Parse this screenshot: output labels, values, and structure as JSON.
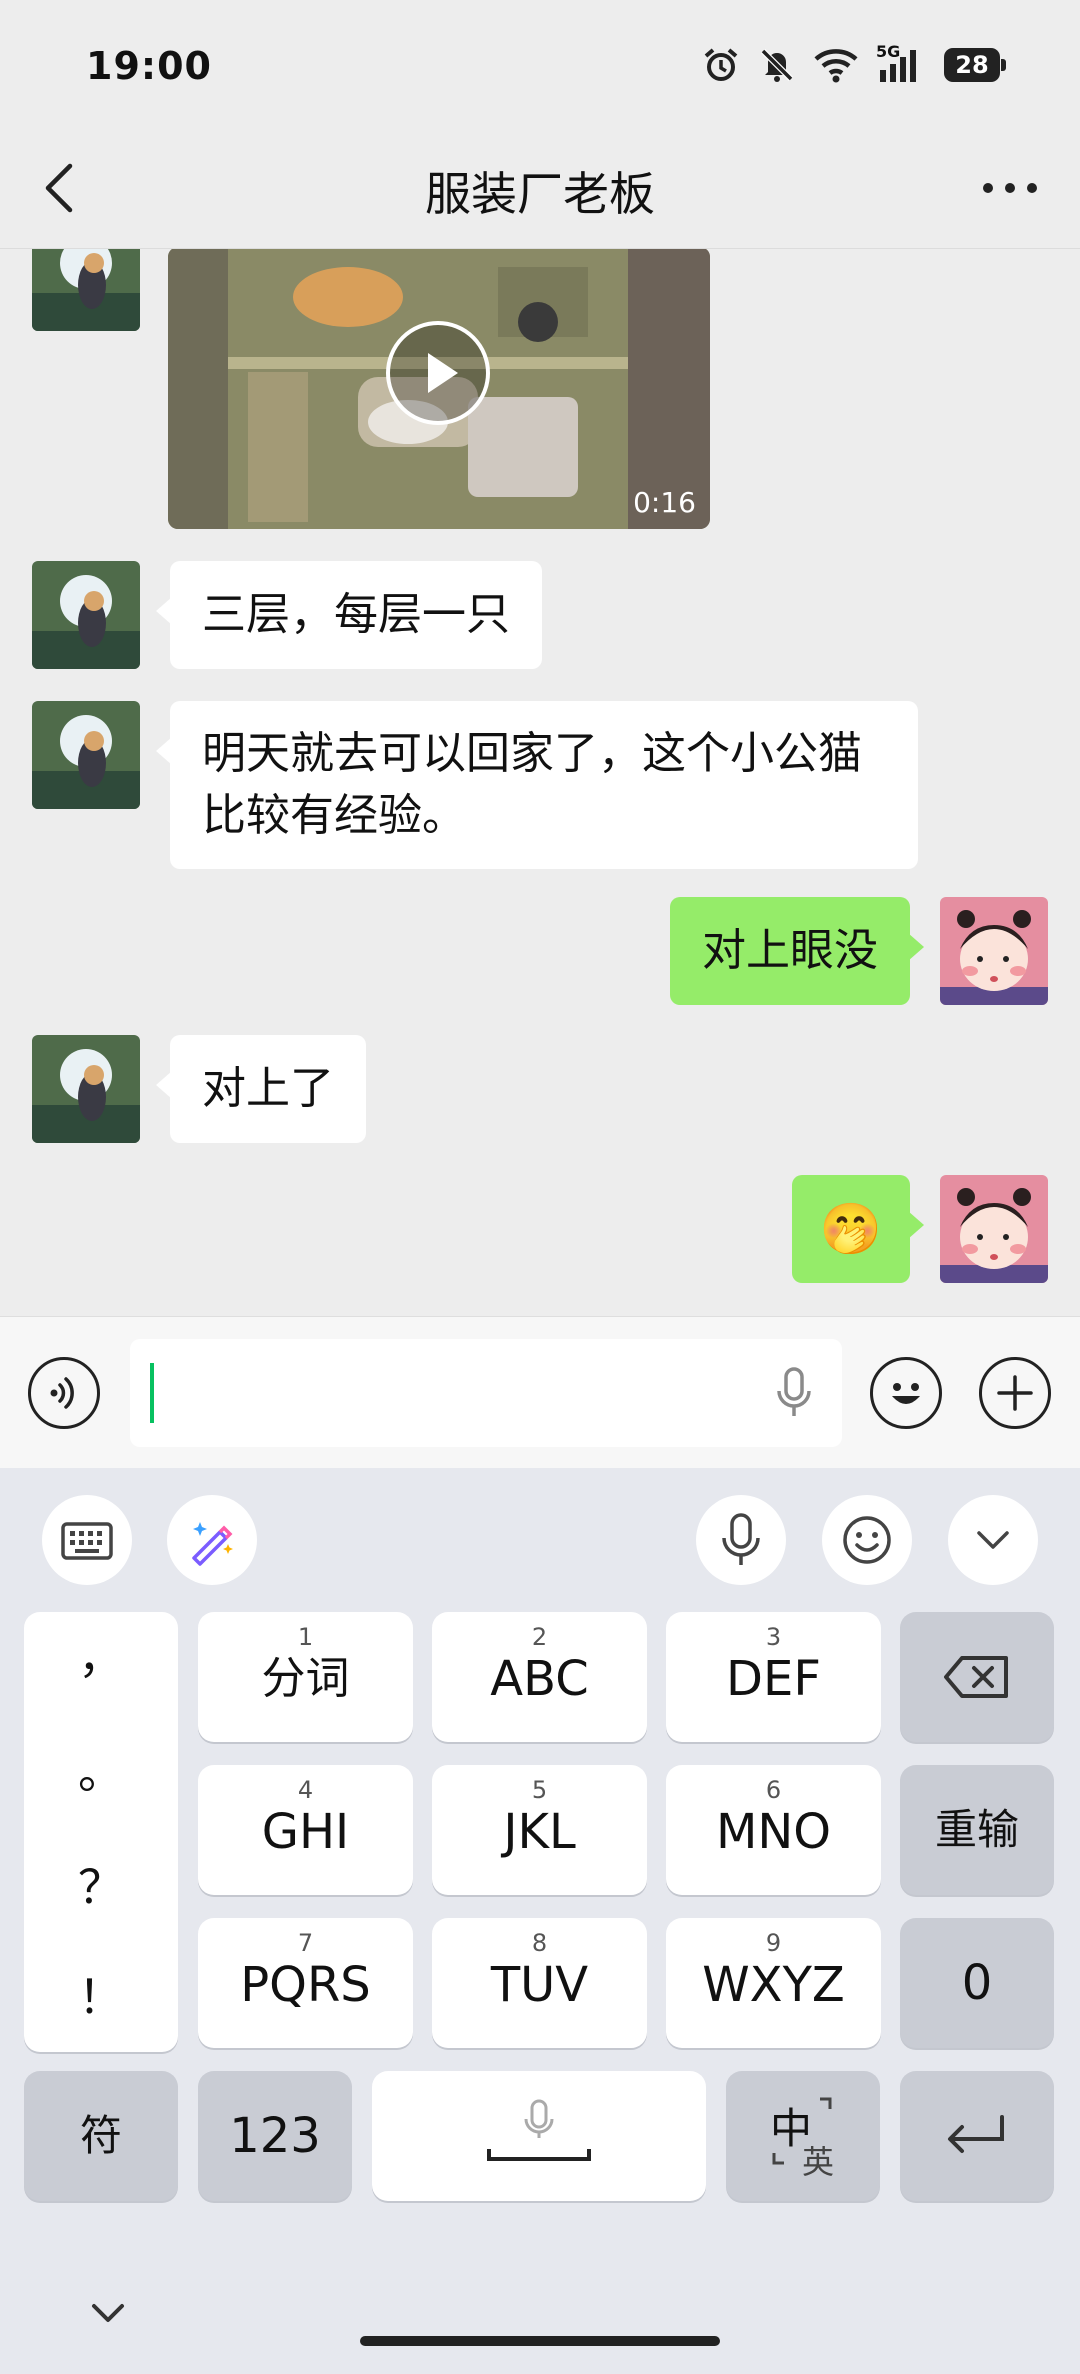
{
  "status_bar": {
    "time": "19:00",
    "network": "5G",
    "battery": "28"
  },
  "header": {
    "title": "服装厂老板"
  },
  "messages": [
    {
      "direction": "in",
      "type": "video",
      "duration": "0:16"
    },
    {
      "direction": "in",
      "type": "text",
      "text": "三层，每层一只"
    },
    {
      "direction": "in",
      "type": "text",
      "text": "明天就去可以回家了，这个小公猫比较有经验。"
    },
    {
      "direction": "out",
      "type": "text",
      "text": "对上眼没"
    },
    {
      "direction": "in",
      "type": "text",
      "text": "对上了"
    },
    {
      "direction": "out",
      "type": "emoji",
      "text": "🤭"
    }
  ],
  "keyboard": {
    "punct": [
      "，",
      "。",
      "？",
      "！"
    ],
    "row1": [
      {
        "num": "1",
        "label": "分词"
      },
      {
        "num": "2",
        "label": "ABC"
      },
      {
        "num": "3",
        "label": "DEF"
      }
    ],
    "row2": [
      {
        "num": "4",
        "label": "GHI"
      },
      {
        "num": "5",
        "label": "JKL"
      },
      {
        "num": "6",
        "label": "MNO"
      }
    ],
    "row3": [
      {
        "num": "7",
        "label": "PQRS"
      },
      {
        "num": "8",
        "label": "TUV"
      },
      {
        "num": "9",
        "label": "WXYZ"
      }
    ],
    "reenter": "重输",
    "zero": "0",
    "symbol": "符",
    "numbers": "123",
    "lang_zh": "中",
    "lang_en": "英"
  },
  "colors": {
    "outgoing_bubble": "#95ec69",
    "incoming_bubble": "#ffffff",
    "caret": "#07c160"
  }
}
